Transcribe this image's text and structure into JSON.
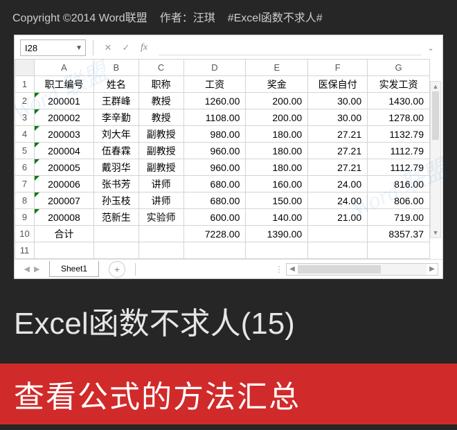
{
  "copyright": {
    "text": "Copyright ©2014 Word联盟",
    "author": "作者：汪琪",
    "hashtag": "#Excel函数不求人#"
  },
  "formula_bar": {
    "name_box": "I28",
    "fx": "fx"
  },
  "columns": [
    "A",
    "B",
    "C",
    "D",
    "E",
    "F",
    "G"
  ],
  "headers": [
    "职工编号",
    "姓名",
    "职称",
    "工资",
    "奖金",
    "医保自付",
    "实发工资"
  ],
  "rows": [
    {
      "n": "2",
      "id": "200001",
      "name": "王群峰",
      "title": "教授",
      "salary": "1260.00",
      "bonus": "200.00",
      "ins": "30.00",
      "net": "1430.00"
    },
    {
      "n": "3",
      "id": "200002",
      "name": "李辛勤",
      "title": "教授",
      "salary": "1108.00",
      "bonus": "200.00",
      "ins": "30.00",
      "net": "1278.00"
    },
    {
      "n": "4",
      "id": "200003",
      "name": "刘大年",
      "title": "副教授",
      "salary": "980.00",
      "bonus": "180.00",
      "ins": "27.21",
      "net": "1132.79"
    },
    {
      "n": "5",
      "id": "200004",
      "name": "伍春霖",
      "title": "副教授",
      "salary": "960.00",
      "bonus": "180.00",
      "ins": "27.21",
      "net": "1112.79"
    },
    {
      "n": "6",
      "id": "200005",
      "name": "戴羽华",
      "title": "副教授",
      "salary": "960.00",
      "bonus": "180.00",
      "ins": "27.21",
      "net": "1112.79"
    },
    {
      "n": "7",
      "id": "200006",
      "name": "张书芳",
      "title": "讲师",
      "salary": "680.00",
      "bonus": "160.00",
      "ins": "24.00",
      "net": "816.00"
    },
    {
      "n": "8",
      "id": "200007",
      "name": "孙玉枝",
      "title": "讲师",
      "salary": "680.00",
      "bonus": "150.00",
      "ins": "24.00",
      "net": "806.00"
    },
    {
      "n": "9",
      "id": "200008",
      "name": "范新生",
      "title": "实验师",
      "salary": "600.00",
      "bonus": "140.00",
      "ins": "21.00",
      "net": "719.00"
    }
  ],
  "totals": {
    "n": "10",
    "label": "合计",
    "salary": "7228.00",
    "bonus": "1390.00",
    "net": "8357.37"
  },
  "empty_row": "11",
  "sheet_tab": "Sheet1",
  "title": "Excel函数不求人(15)",
  "subtitle": "查看公式的方法汇总",
  "watermark": "Word 联盟"
}
